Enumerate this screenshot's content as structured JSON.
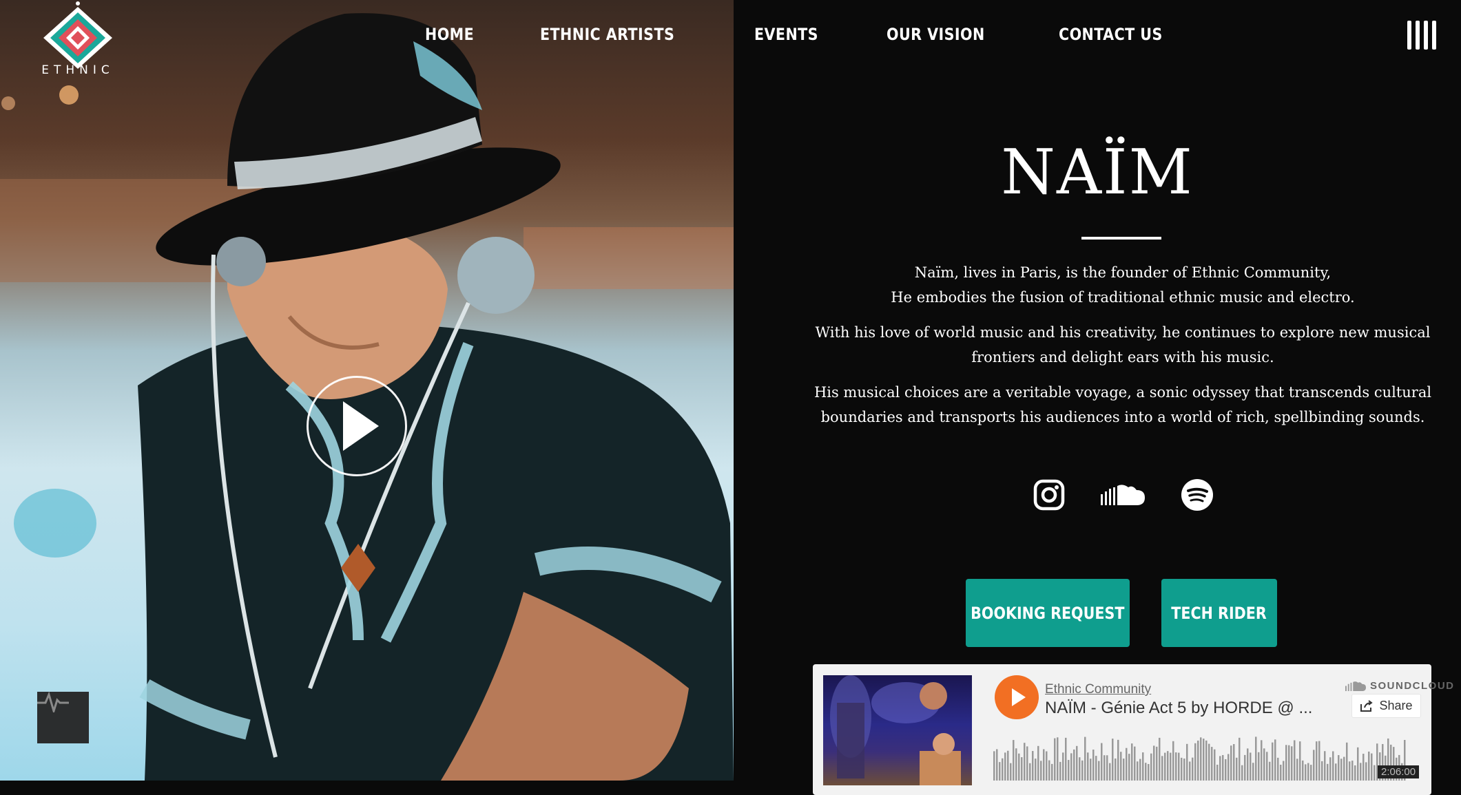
{
  "brand": {
    "logo_text": "ETHNIC"
  },
  "nav": {
    "items": [
      "HOME",
      "ETHNIC ARTISTS",
      "EVENTS",
      "OUR VISION",
      "CONTACT US"
    ]
  },
  "artist": {
    "name": "NAÏM",
    "bio": [
      "Naïm, lives in Paris, is the founder of Ethnic Community,",
      "He embodies the fusion of traditional ethnic music and electro.",
      "With his love of world music and his creativity, he continues to explore new musical frontiers and delight ears with his music.",
      "His musical choices are a veritable voyage, a sonic odyssey that transcends cultural boundaries and transports his audiences into a world of rich, spellbinding sounds."
    ]
  },
  "socials": [
    "instagram-icon",
    "soundcloud-icon",
    "spotify-icon"
  ],
  "buttons": {
    "booking": "BOOKING REQUEST",
    "tech": "TECH RIDER"
  },
  "player": {
    "artist": "Ethnic Community",
    "track": "NAÏM - Génie Act 5 by HORDE @ ...",
    "brand": "SOUNDCLOUD",
    "share": "Share",
    "duration": "2:06:00"
  },
  "colors": {
    "accent": "#0f9e8e",
    "background": "#0a0a0a",
    "player_orange": "#f26f23"
  }
}
